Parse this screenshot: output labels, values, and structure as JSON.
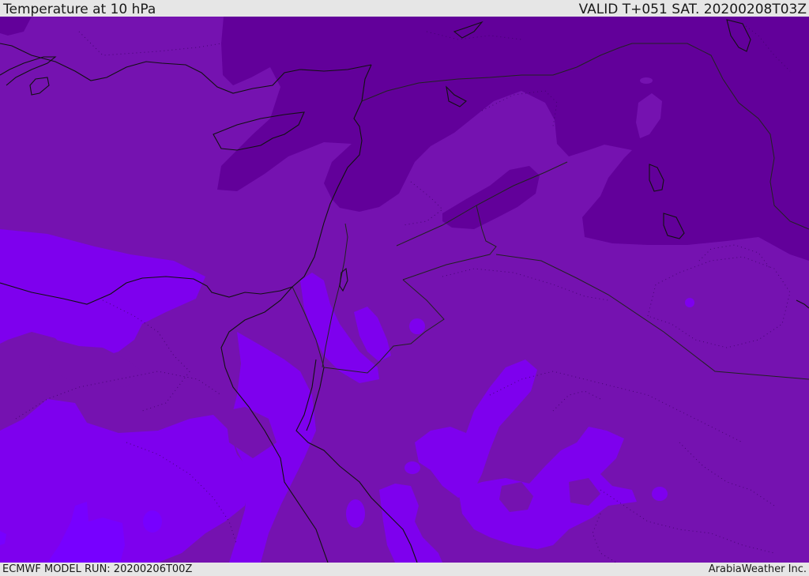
{
  "header": {
    "title": "Temperature at 10 hPa",
    "valid_time": "VALID T+051 SAT. 20200208T03Z"
  },
  "footer": {
    "model_run": "ECMWF MODEL RUN: 20200206T00Z",
    "brand": "ArabiaWeather Inc."
  },
  "map": {
    "colors": {
      "darkest": "#62009a",
      "dark": "#7512b0",
      "mid": "#7a05d6",
      "bright": "#7e00ee",
      "brightest": "#7700ff",
      "coastline": "#111111",
      "border": "#222222"
    }
  }
}
